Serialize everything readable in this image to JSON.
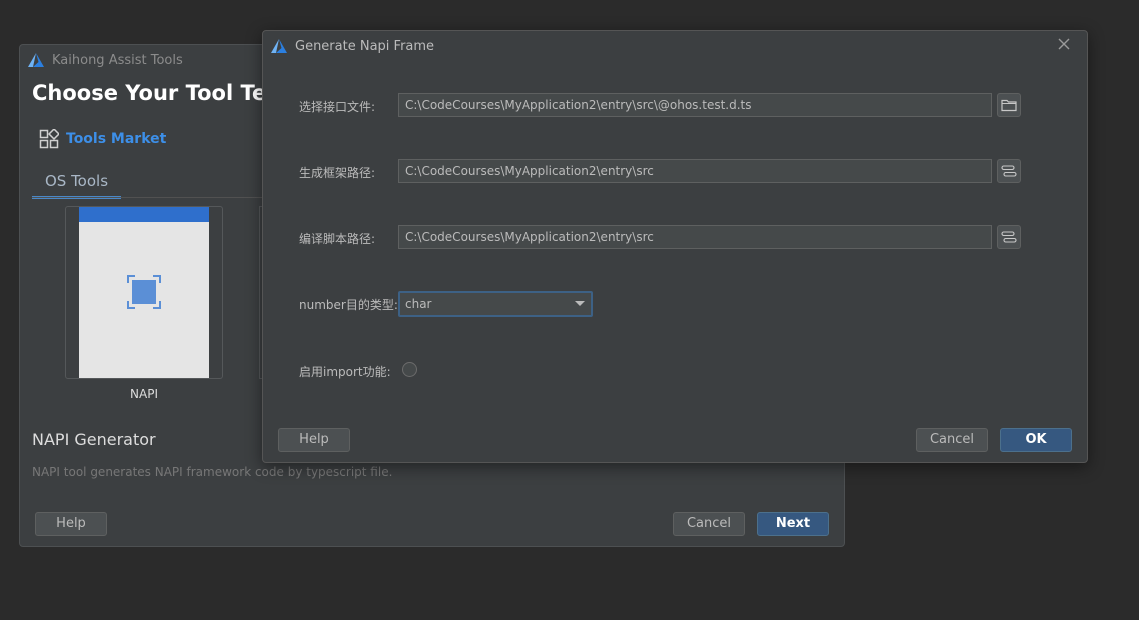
{
  "background_window": {
    "title": "Kaihong Assist Tools",
    "heading": "Choose Your Tool Temp",
    "tools_market_label": "Tools Market",
    "tab_label": "OS Tools",
    "card_label": "NAPI",
    "generator_title": "NAPI Generator",
    "generator_description": "NAPI tool generates NAPI framework code by typescript file.",
    "help_label": "Help",
    "cancel_label": "Cancel",
    "next_label": "Next"
  },
  "dialog": {
    "title": "Generate Napi Frame",
    "interface_file": {
      "label": "选择接口文件:",
      "value": "C:\\CodeCourses\\MyApplication2\\entry\\src\\@ohos.test.d.ts"
    },
    "gen_path": {
      "label": "生成框架路径:",
      "value": "C:\\CodeCourses\\MyApplication2\\entry\\src"
    },
    "build_path": {
      "label": "编译脚本路径:",
      "value": "C:\\CodeCourses\\MyApplication2\\entry\\src"
    },
    "number_type": {
      "label": "number目的类型:",
      "selected": "char"
    },
    "import": {
      "label": "启用import功能:",
      "enabled": false
    },
    "help_label": "Help",
    "cancel_label": "Cancel",
    "ok_label": "OK"
  },
  "icons": {
    "app_logo": "harmony-logo-icon",
    "tools_market": "grid-apps-icon",
    "folder": "folder-icon",
    "path_select": "path-select-icon",
    "close": "close-icon",
    "napi_card": "focus-square-icon"
  },
  "colors": {
    "accent_blue": "#3d8fe8",
    "primary_button": "#365880",
    "card_topbar": "#2f6fcc",
    "logo_light": "#6fb3f5",
    "logo_dark": "#2b7fe0"
  }
}
